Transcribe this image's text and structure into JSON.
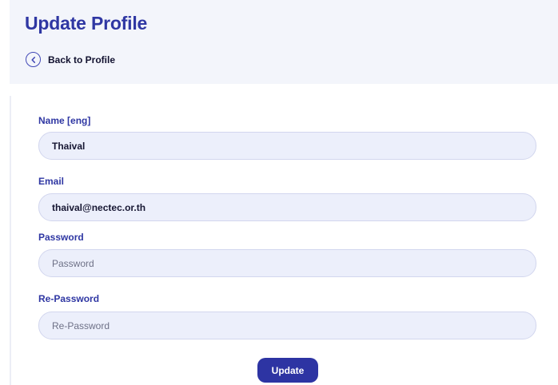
{
  "page": {
    "title": "Update Profile",
    "back_label": "Back to Profile"
  },
  "form": {
    "name": {
      "label": "Name [eng]",
      "value": "Thaival"
    },
    "email": {
      "label": "Email",
      "value": "thaival@nectec.or.th"
    },
    "password": {
      "label": "Password",
      "placeholder": "Password"
    },
    "repassword": {
      "label": "Re-Password",
      "placeholder": "Re-Password"
    },
    "submit_label": "Update"
  },
  "icons": {
    "back": "chevron-left-circle-icon"
  },
  "colors": {
    "primary": "#2f37a3",
    "input_background": "#eceffb",
    "header_background": "#f3f5fb",
    "text": "#171733"
  }
}
